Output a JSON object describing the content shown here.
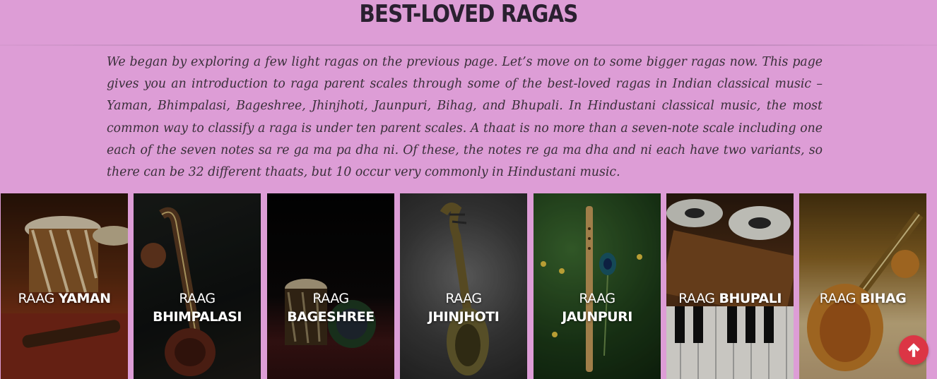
{
  "page": {
    "title": "BEST-LOVED RAGAS",
    "intro": "We began by exploring a few light ragas on the previous page. Let’s move on to some bigger ragas now. This page gives you an introduction to raga parent scales through some of the best-loved ragas in Indian classical music – Yaman, Bhimpalasi, Bageshree, Jhinjhoti, Jaunpuri, Bihag, and Bhupali. In Hindustani classical music, the most common way to classify a raga is under ten parent scales. A thaat is no more than a seven-note scale including one each of the seven notes sa re ga ma pa dha ni. Of these, the notes re ga ma dha and ni each have two variants, so there can be 32 different thaats, but 10 occur very commonly in Hindustani music."
  },
  "cards": [
    {
      "prefix": "RAAG",
      "name": "YAMAN",
      "image": "tabla-drums-image"
    },
    {
      "prefix": "RAAG",
      "name": "BHIMPALASI",
      "image": "veena-image"
    },
    {
      "prefix": "RAAG",
      "name": "BAGESHREE",
      "image": "drum-image"
    },
    {
      "prefix": "RAAG",
      "name": "JHINJHOTI",
      "image": "sarangi-image"
    },
    {
      "prefix": "RAAG",
      "name": "JAUNPURI",
      "image": "flute-peacock-feather-image"
    },
    {
      "prefix": "RAAG",
      "name": "BHUPALI",
      "image": "harmonium-tabla-image"
    },
    {
      "prefix": "RAAG",
      "name": "BIHAG",
      "image": "veena-image"
    }
  ],
  "scroll_top": {
    "icon": "arrow-up-icon",
    "color": "#dc3545"
  },
  "colors": {
    "background": "#dd9dd6",
    "title": "#2a2030",
    "text": "#3a2f3a"
  }
}
